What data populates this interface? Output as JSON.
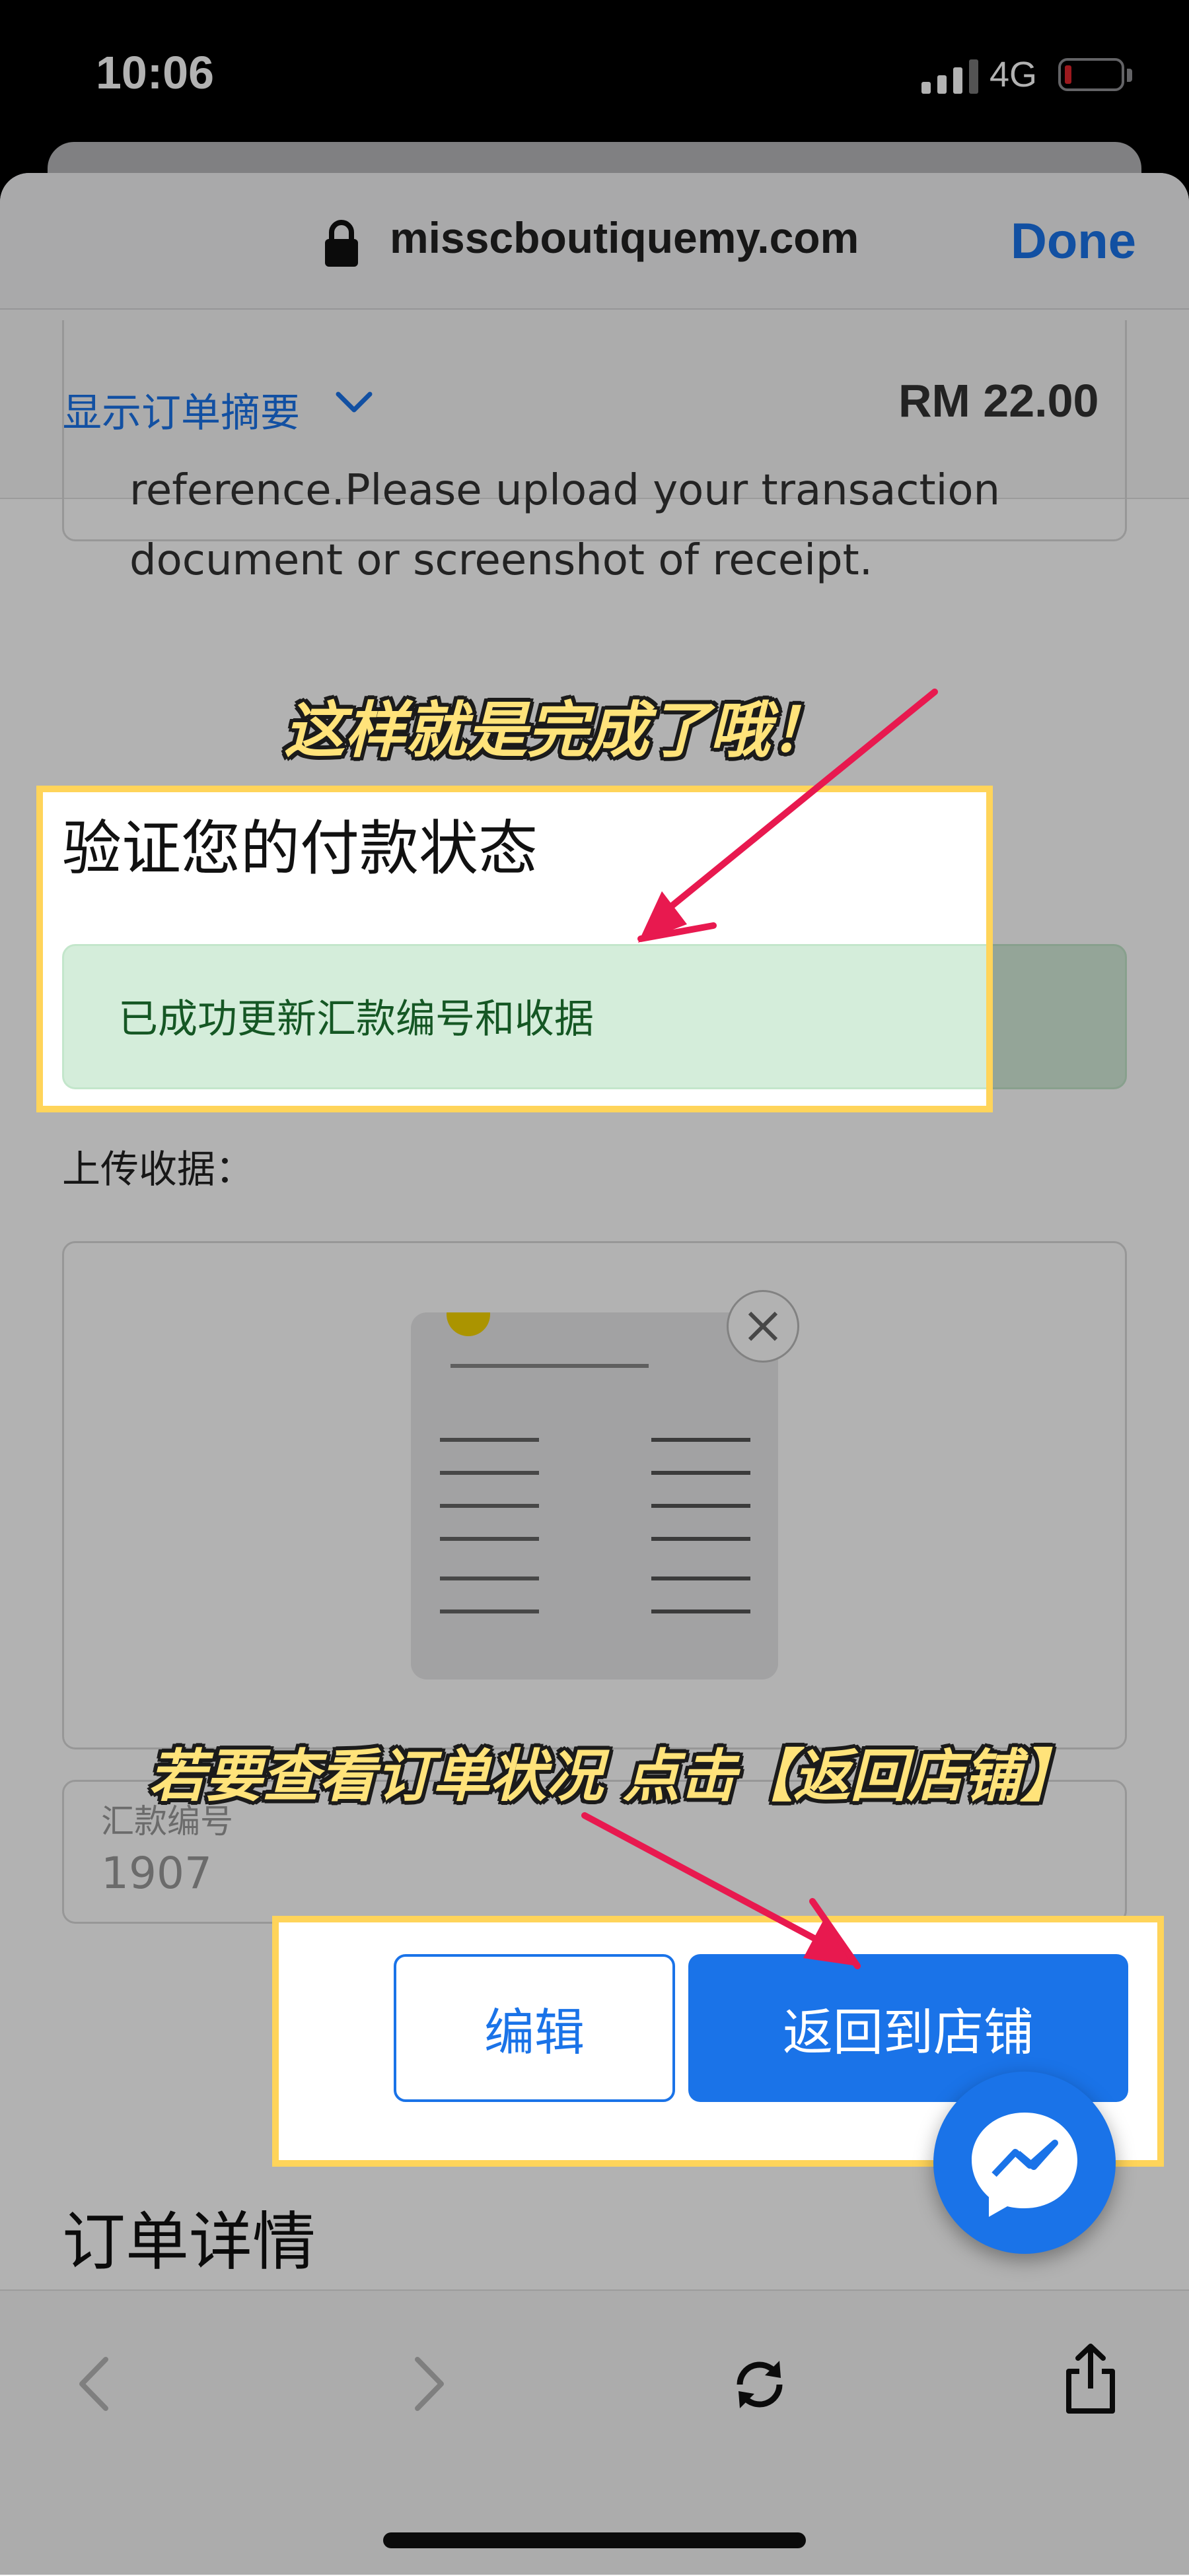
{
  "status_bar": {
    "time": "10:06",
    "network": "4G",
    "battery_color": "#e0252c"
  },
  "browser": {
    "url": "misscboutiquemy.com",
    "done_label": "Done"
  },
  "order_summary": {
    "toggle_label": "显示订单摘要",
    "total": "RM 22.00"
  },
  "instructions": {
    "line1": "reference.Please upload your transaction",
    "line2": "document or screenshot of receipt."
  },
  "verify": {
    "title": "验证您的付款状态",
    "success_message": "已成功更新汇款编号和收据"
  },
  "upload": {
    "label": "上传收据："
  },
  "reference": {
    "label": "汇款编号",
    "value": "1907"
  },
  "buttons": {
    "edit": "编辑",
    "return_to_store": "返回到店铺"
  },
  "order_details": {
    "title": "订单详情"
  },
  "annotations": {
    "note1": "这样就是完成了哦！",
    "note2": "若要查看订单状况 点击【返回店铺】",
    "highlight_color": "#ffd45a",
    "arrow_color": "#e8194f"
  },
  "colors": {
    "accent": "#1a73e8",
    "success_bg": "#d4edda",
    "success_text": "#155724"
  },
  "icons": [
    "lock-icon",
    "chevron-down-icon",
    "close-icon",
    "back-icon",
    "forward-icon",
    "reload-icon",
    "share-icon",
    "messenger-icon"
  ]
}
